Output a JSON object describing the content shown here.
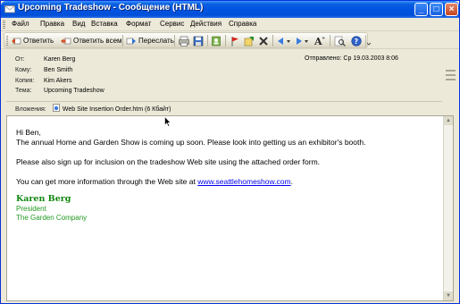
{
  "window": {
    "title": "Upcoming Tradeshow - Сообщение (HTML)",
    "controls": {
      "minimize": "_",
      "maximize": "□",
      "close": "×"
    }
  },
  "menu": [
    {
      "label": "Файл"
    },
    {
      "label": "Правка"
    },
    {
      "label": "Вид"
    },
    {
      "label": "Вставка"
    },
    {
      "label": "Формат"
    },
    {
      "label": "Сервис"
    },
    {
      "label": "Действия"
    },
    {
      "label": "Справка"
    }
  ],
  "toolbar": {
    "reply": "Ответить",
    "reply_all": "Ответить всем",
    "forward": "Переслать",
    "icons": [
      "print-icon",
      "save-icon",
      "addressbook-icon",
      "flag-icon",
      "move-icon",
      "delete-icon",
      "previous-icon",
      "next-icon",
      "font-size-icon",
      "find-icon",
      "help-icon"
    ]
  },
  "header": {
    "from_label": "От:",
    "from": "Karen Berg",
    "to_label": "Кому:",
    "to": "Ben Smith",
    "cc_label": "Копия:",
    "cc": "Kim Akers",
    "subject_label": "Тема:",
    "subject": "Upcoming Tradeshow",
    "sent_label": "Отправлено:",
    "sent": "Ср 19.03.2003 8:06",
    "attachments_label": "Вложения:",
    "attachment": "Web Site Insertion Order.htm (6 Кбайт)"
  },
  "body": {
    "greeting": "Hi Ben,",
    "line1": "The annual Home and Garden Show is coming up soon.  Please look into getting us an exhibitor's booth.",
    "line2": "Please also sign up for inclusion on the tradeshow Web site using the attached order form.",
    "line3_prefix": "You can get more information through the Web site at ",
    "link": "www.seattlehomeshow.com",
    "line3_suffix": ".",
    "signature_name": "Karen Berg",
    "signature_title": "President",
    "signature_company": "The Garden Company"
  },
  "colors": {
    "titlebar": "#0054e3",
    "signature": "#118811",
    "link": "#0000ee"
  }
}
